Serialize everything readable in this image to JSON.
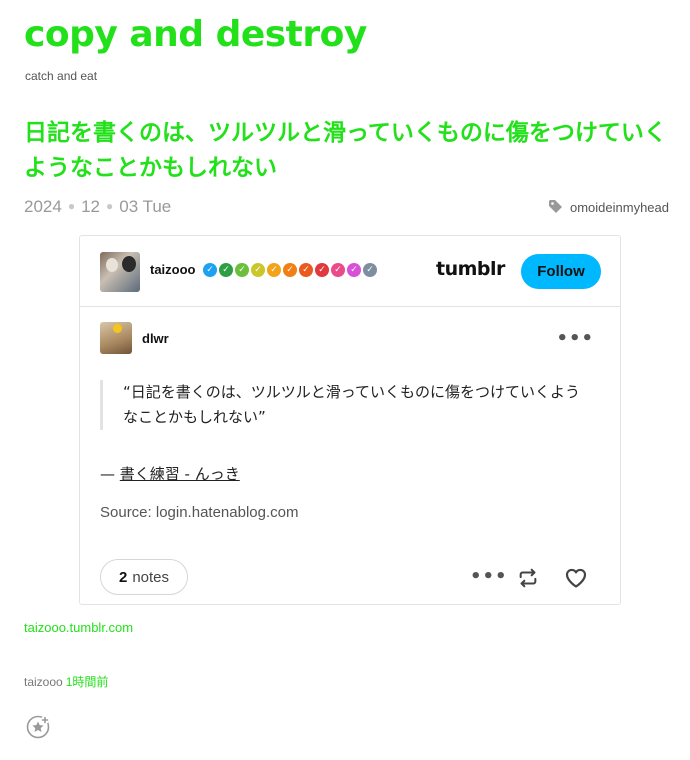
{
  "site": {
    "title": "copy and destroy",
    "description": "catch and eat"
  },
  "post": {
    "title": "日記を書くのは、ツルツルと滑っていくものに傷をつけていくようなことかもしれない",
    "date": {
      "year": "2024",
      "month": "12",
      "day": "03 Tue"
    },
    "tag": "omoideinmyhead",
    "source_url_text": "taizooo.tumblr.com",
    "author": "taizooo",
    "time_ago": "1時間前"
  },
  "embed": {
    "blog_name": "taizooo",
    "tumblr_logo": "tumblr",
    "follow_label": "Follow",
    "reblog_name": "dlwr",
    "quote": "“日記を書くのは、ツルツルと滑っていくものに傷をつけていくようなことかもしれない”",
    "quote_source_prefix": "— ",
    "quote_source_link": "書く練習 - んっき",
    "source_label": "Source: login.hatenablog.com",
    "notes_count": "2",
    "notes_label": "notes",
    "badge_colors": [
      "#1da1f2",
      "#2e9e44",
      "#6bbf3a",
      "#c9c72a",
      "#f2a31a",
      "#f07f14",
      "#ea5a1e",
      "#e0393e",
      "#ea4c89",
      "#d94fd6",
      "#7e8ea0"
    ]
  },
  "colors": {
    "accent": "#22e11a",
    "follow_button": "#00b8ff"
  },
  "icons": [
    "tag-icon",
    "more-icon",
    "reblog-icon",
    "heart-icon",
    "favorite-star-icon"
  ]
}
